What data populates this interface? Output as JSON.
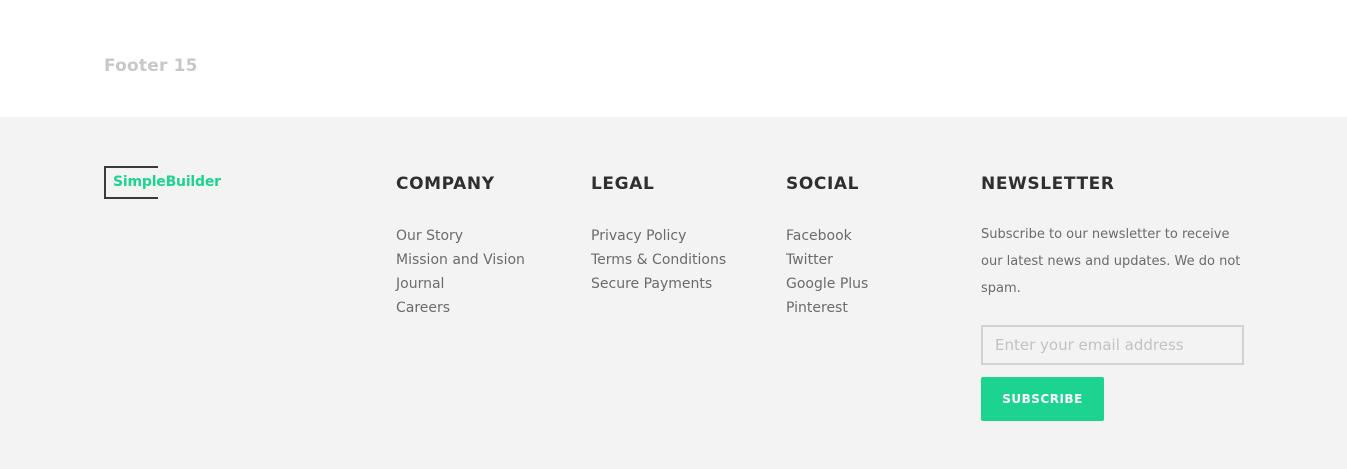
{
  "section": {
    "label": "Footer 15"
  },
  "brand": {
    "name": "SimpleBuilder",
    "accent_color": "#1cd48f"
  },
  "columns": {
    "company": {
      "heading": "COMPANY",
      "links": [
        "Our Story",
        "Mission and Vision",
        "Journal",
        "Careers"
      ]
    },
    "legal": {
      "heading": "LEGAL",
      "links": [
        "Privacy Policy",
        "Terms & Conditions",
        "Secure Payments"
      ]
    },
    "social": {
      "heading": "SOCIAL",
      "links": [
        "Facebook",
        "Twitter",
        "Google Plus",
        "Pinterest"
      ]
    }
  },
  "newsletter": {
    "heading": "NEWSLETTER",
    "description": "Subscribe to our newsletter to receive our latest news and updates. We do not spam.",
    "email_placeholder": "Enter your email address",
    "email_value": "",
    "button_label": "SUBSCRIBE"
  },
  "colors": {
    "footer_background": "#f3f3f3",
    "heading": "#2f2f2f",
    "link": "#6b6b6b",
    "accent": "#1cd48f"
  }
}
